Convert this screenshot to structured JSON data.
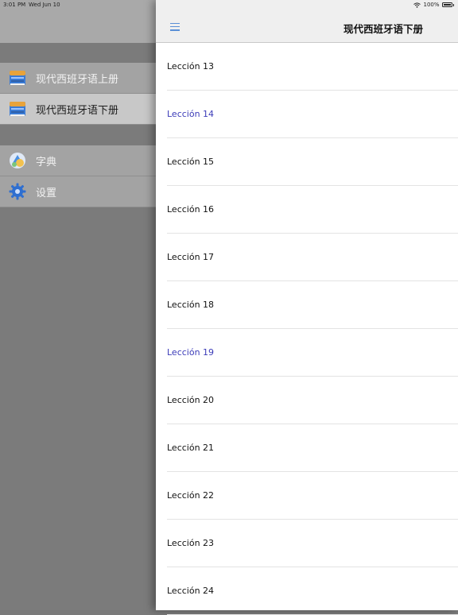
{
  "status_bar": {
    "time": "3:01 PM",
    "date": "Wed Jun 10",
    "battery": "100%"
  },
  "sidebar": {
    "books": [
      {
        "label": "现代西班牙语上册",
        "selected": false
      },
      {
        "label": "现代西班牙语下册",
        "selected": true
      }
    ],
    "tools": [
      {
        "label": "字典"
      },
      {
        "label": "设置"
      }
    ]
  },
  "navbar": {
    "title": "现代西班牙语下册"
  },
  "lessons": [
    {
      "label": "Lección 13",
      "highlighted": false
    },
    {
      "label": "Lección 14",
      "highlighted": true
    },
    {
      "label": "Lección 15",
      "highlighted": false
    },
    {
      "label": "Lección 16",
      "highlighted": false
    },
    {
      "label": "Lección 17",
      "highlighted": false
    },
    {
      "label": "Lección 18",
      "highlighted": false
    },
    {
      "label": "Lección 19",
      "highlighted": true
    },
    {
      "label": "Lección 20",
      "highlighted": false
    },
    {
      "label": "Lección 21",
      "highlighted": false
    },
    {
      "label": "Lección 22",
      "highlighted": false
    },
    {
      "label": "Lección 23",
      "highlighted": false
    },
    {
      "label": "Lección 24",
      "highlighted": false
    }
  ],
  "colors": {
    "highlight_text": "#3b3bb8",
    "menu_icon": "#5a8fd6"
  },
  "icons": {
    "book": "book-icon",
    "dictionary": "dictionary-icon",
    "settings": "gear-icon",
    "menu": "hamburger-menu-icon"
  }
}
